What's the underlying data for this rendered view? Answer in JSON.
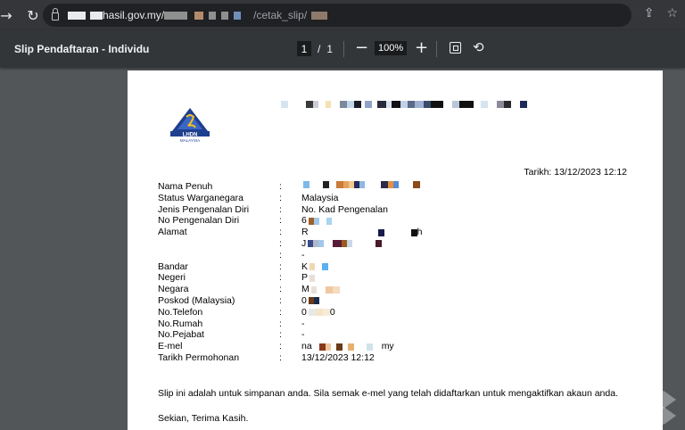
{
  "browser": {
    "url_host": "hasil.gov.my/",
    "url_path": "/cetak_slip/",
    "back_icon": "arrow-left-icon",
    "reload_icon": "reload-icon",
    "share_icon": "share-icon",
    "bookmark_icon": "star-icon"
  },
  "pdf": {
    "title": "Slip Pendaftaran - Individu",
    "page_current": "1",
    "page_sep": "/",
    "page_total": "1",
    "zoom_out": "−",
    "zoom": "100%",
    "zoom_in": "+"
  },
  "document": {
    "logo_text": "LHDN",
    "logo_subtext": "MALAYSIA",
    "datetime": "Tarikh: 13/12/2023 12:12",
    "fields": [
      {
        "label": "Nama Penuh",
        "value": ""
      },
      {
        "label": "Status Warganegara",
        "value": "Malaysia"
      },
      {
        "label": "Jenis Pengenalan Diri",
        "value": "No. Kad Pengenalan"
      },
      {
        "label": "No Pengenalan Diri",
        "value": "6"
      },
      {
        "label": "Alamat",
        "value": "R"
      },
      {
        "label": "",
        "value": "J"
      },
      {
        "label": "",
        "value": "-"
      },
      {
        "label": "Bandar",
        "value": "K"
      },
      {
        "label": "Negeri",
        "value": "P"
      },
      {
        "label": "Negara",
        "value": "M"
      },
      {
        "label": "Poskod (Malaysia)",
        "value": "0"
      },
      {
        "label": "No.Telefon",
        "value": "0"
      },
      {
        "label": "No.Rumah",
        "value": "-"
      },
      {
        "label": "No.Pejabat",
        "value": "-"
      },
      {
        "label": "E-mel",
        "value": "na"
      },
      {
        "label": "Tarikh Permohonan",
        "value": "13/12/2023 12:12"
      }
    ],
    "colon": ":",
    "email_suffix": "my",
    "phone_suffix": "0",
    "address_suffix": "h",
    "note": "Slip ini adalah untuk simpanan anda. Sila semak e-mel yang telah didaftarkan untuk mengaktifkan akaun anda.",
    "closing": "Sekian, Terima Kasih."
  }
}
